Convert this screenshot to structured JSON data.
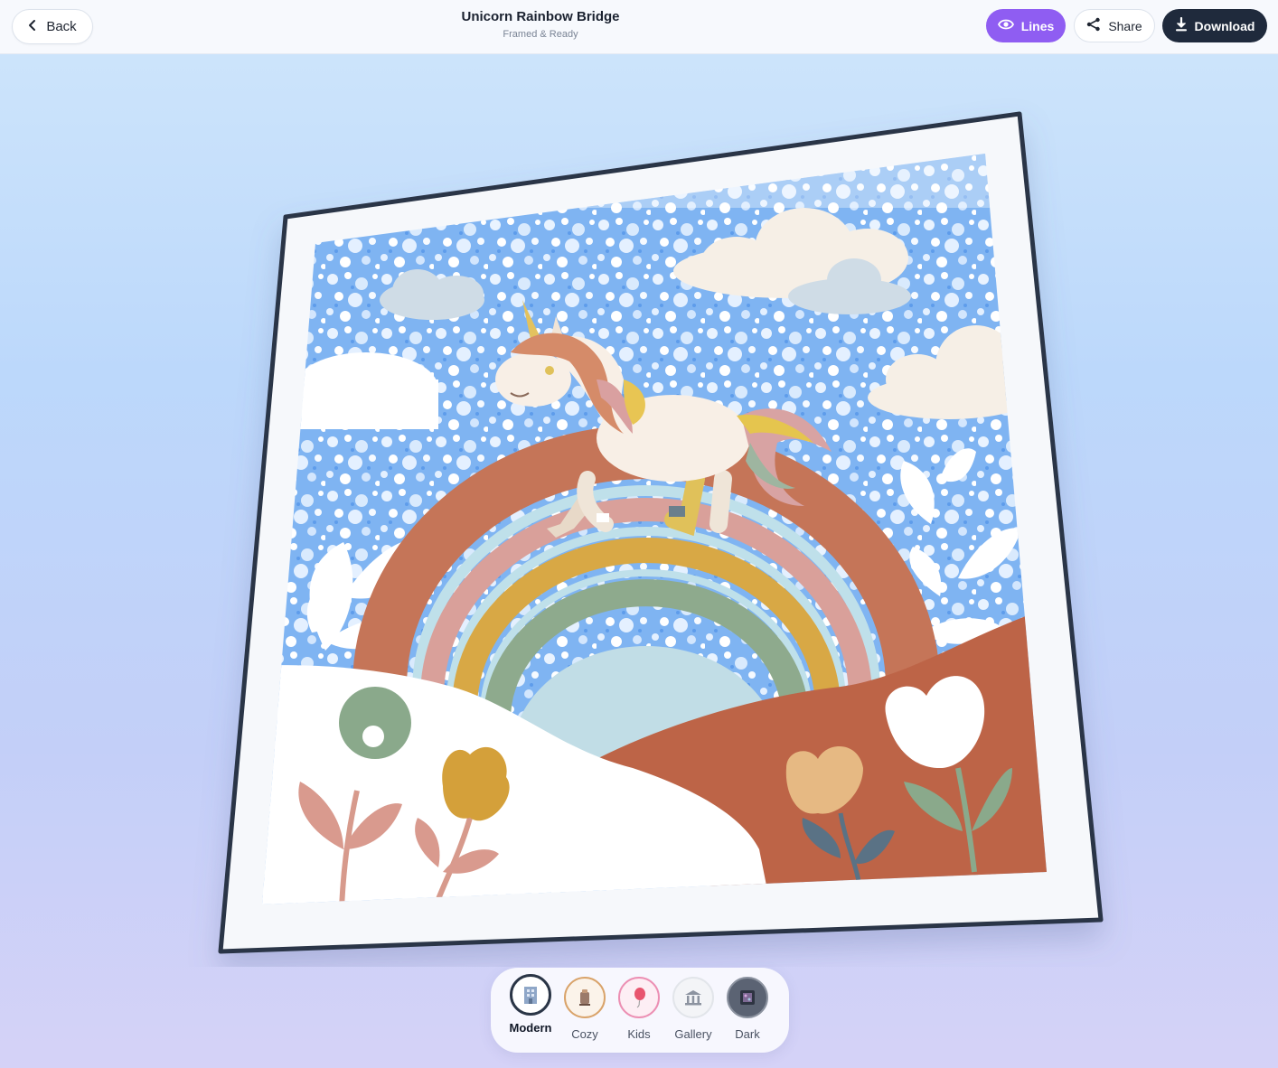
{
  "header": {
    "back_label": "Back",
    "title": "Unicorn Rainbow Bridge",
    "subtitle": "Framed & Ready",
    "lines_label": "Lines",
    "share_label": "Share",
    "download_label": "Download"
  },
  "colors": {
    "lines_accent": "#8f5df2",
    "download_bg": "#1f2a3c",
    "frame_border": "#2a3546"
  },
  "rooms": [
    {
      "label": "Modern",
      "icon": "office-building-icon",
      "active": true
    },
    {
      "label": "Cozy",
      "icon": "cozy-lamp-icon",
      "active": false
    },
    {
      "label": "Kids",
      "icon": "balloon-icon",
      "active": false
    },
    {
      "label": "Gallery",
      "icon": "museum-icon",
      "active": false
    },
    {
      "label": "Dark",
      "icon": "dark-room-icon",
      "active": false
    }
  ]
}
